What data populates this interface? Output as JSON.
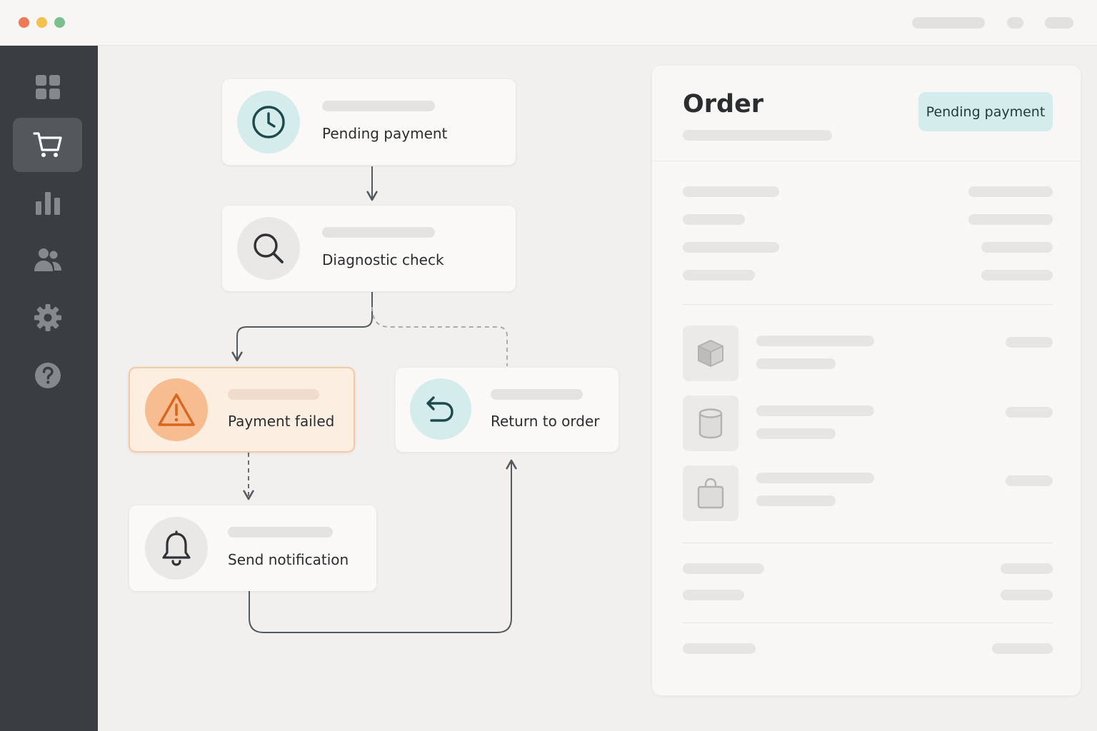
{
  "window": {
    "controls": [
      {
        "name": "close",
        "color": "#ee7a55"
      },
      {
        "name": "minimize",
        "color": "#f2c14e"
      },
      {
        "name": "maximize",
        "color": "#7cbf8e"
      }
    ]
  },
  "sidebar": {
    "items": [
      {
        "id": "dashboard",
        "icon": "grid-icon",
        "active": false
      },
      {
        "id": "orders",
        "icon": "cart-icon",
        "active": true
      },
      {
        "id": "analytics",
        "icon": "bar-chart-icon",
        "active": false
      },
      {
        "id": "customers",
        "icon": "users-icon",
        "active": false
      },
      {
        "id": "settings",
        "icon": "gear-icon",
        "active": false
      },
      {
        "id": "help",
        "icon": "help-icon",
        "active": false
      }
    ]
  },
  "flow": {
    "nodes": [
      {
        "id": "pending-payment",
        "label": "Pending payment",
        "icon": "clock-icon",
        "state": "normal"
      },
      {
        "id": "diagnostic-check",
        "label": "Diagnostic check",
        "icon": "search-icon",
        "state": "normal"
      },
      {
        "id": "payment-failed",
        "label": "Payment failed",
        "icon": "warning-icon",
        "state": "alert"
      },
      {
        "id": "return-to-order",
        "label": "Return to order",
        "icon": "return-icon",
        "state": "normal"
      },
      {
        "id": "send-notification",
        "label": "Send notification",
        "icon": "bell-icon",
        "state": "normal"
      }
    ],
    "colors": {
      "accent": "#d5ecec",
      "alert": "#fdeee2",
      "alert_border": "#f6c9a4",
      "warning_icon": "#d9661f"
    }
  },
  "order_panel": {
    "title": "Order",
    "status_badge": "Pending payment",
    "line_item_icons": [
      "box-icon",
      "cylinder-icon",
      "bag-icon"
    ]
  }
}
